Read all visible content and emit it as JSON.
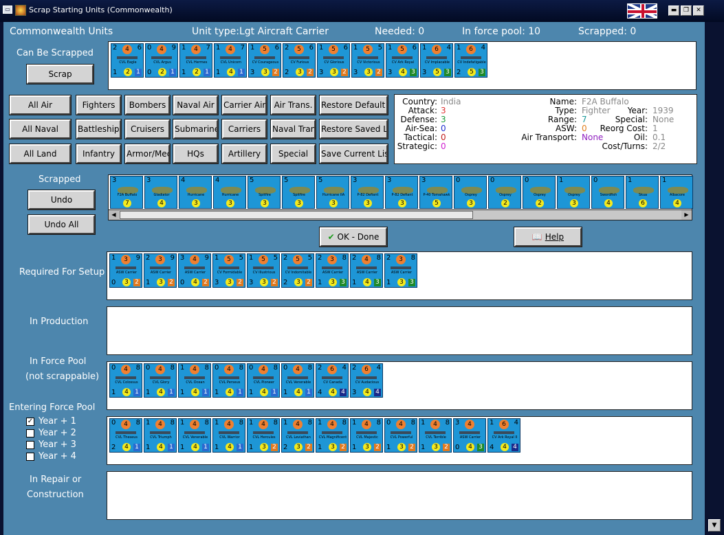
{
  "window": {
    "title": "Scrap Starting Units (Commonwealth)"
  },
  "header": {
    "units_title": "Commonwealth Units",
    "unit_type": "Unit type:Lgt Aircraft Carrier",
    "needed": "Needed:  0",
    "in_force_pool": "In force pool: 10",
    "scrapped": "Scrapped:  0"
  },
  "labels": {
    "can_be_scrapped": "Can Be Scrapped",
    "scrapped": "Scrapped",
    "required_for_setup": "Required For Setup",
    "in_production": "In Production",
    "in_force_pool": "In Force Pool",
    "not_scrappable": "(not scrappable)",
    "entering_force_pool": "Entering Force Pool",
    "in_repair": "In Repair or",
    "construction": "Construction"
  },
  "buttons": {
    "scrap": "Scrap",
    "undo": "Undo",
    "undo_all": "Undo All",
    "ok_done": "OK - Done",
    "help": "Help",
    "all_air": "All Air",
    "fighters": "Fighters",
    "bombers": "Bombers",
    "naval_air": "Naval Air",
    "carrier_air": "Carrier Air",
    "air_trans": "Air Trans.",
    "restore_default": "Restore Default List",
    "all_naval": "All Naval",
    "battleships": "Battleships",
    "cruisers": "Cruisers",
    "submarines": "Submarines",
    "carriers": "Carriers",
    "naval_trans": "Naval Trans.",
    "restore_saved": "Restore Saved List",
    "all_land": "All Land",
    "infantry": "Infantry",
    "armor_mech": "Armor/Mech",
    "hqs": "HQs",
    "artillery": "Artillery",
    "special": "Special",
    "save_current": "Save Current List"
  },
  "info": {
    "country_label": "Country:",
    "country": "India",
    "attack_label": "Attack:",
    "attack": "3",
    "defense_label": "Defense:",
    "defense": "3",
    "air_sea_label": "Air-Sea:",
    "air_sea": "0",
    "tactical_label": "Tactical:",
    "tactical": "0",
    "strategic_label": "Strategic:",
    "strategic": "0",
    "name_label": "Name:",
    "name": "F2A Buffalo",
    "type_label": "Type:",
    "type": "Fighter",
    "range_label": "Range:",
    "range": "7",
    "asw_label": "ASW:",
    "asw": "0",
    "air_transport_label": "Air Transport:",
    "air_transport": "None",
    "year_label": "Year:",
    "year": "1939",
    "special_label": "Special:",
    "special": "None",
    "reorg_label": "Reorg Cost:",
    "reorg": "1",
    "oil_label": "Oil:",
    "oil": "0.1",
    "cost_label": "Cost/Turns:",
    "cost": "2/2"
  },
  "entering": [
    {
      "label": "Year + 1",
      "checked": "✓"
    },
    {
      "label": "Year + 2",
      "checked": ""
    },
    {
      "label": "Year + 3",
      "checked": ""
    },
    {
      "label": "Year + 4",
      "checked": ""
    }
  ],
  "can_be_scrapped_units": [
    {
      "tl": "2",
      "c1": "4",
      "tr": "6",
      "name": "CVL Eagle",
      "bl": "1",
      "bc": "2",
      "br": "1",
      "brc": "#2a6ad0"
    },
    {
      "tl": "0",
      "c1": "4",
      "tr": "9",
      "name": "CVL Argus",
      "bl": "0",
      "bc": "2",
      "br": "1",
      "brc": "#2a6ad0"
    },
    {
      "tl": "1",
      "c1": "4",
      "tr": "7",
      "name": "CVL Hermes",
      "bl": "1",
      "bc": "2",
      "br": "1",
      "brc": "#2a6ad0"
    },
    {
      "tl": "1",
      "c1": "4",
      "tr": "7",
      "name": "CVL Unicorn",
      "bl": "1",
      "bc": "4",
      "br": "1",
      "brc": "#2a6ad0"
    },
    {
      "tl": "1",
      "c1": "5",
      "tr": "6",
      "name": "CV Courageous",
      "bl": "3",
      "bc": "3",
      "br": "2",
      "brc": "#e07a20"
    },
    {
      "tl": "2",
      "c1": "5",
      "tr": "6",
      "name": "CV Furious",
      "bl": "2",
      "bc": "3",
      "br": "2",
      "brc": "#e07a20"
    },
    {
      "tl": "1",
      "c1": "5",
      "tr": "6",
      "name": "CV Glorious",
      "bl": "3",
      "bc": "3",
      "br": "2",
      "brc": "#e07a20"
    },
    {
      "tl": "1",
      "c1": "5",
      "tr": "5",
      "name": "CV Victorious",
      "bl": "3",
      "bc": "3",
      "br": "2",
      "brc": "#e07a20"
    },
    {
      "tl": "1",
      "c1": "5",
      "tr": "6",
      "name": "CV Ark Royal",
      "bl": "3",
      "bc": "4",
      "br": "3",
      "brc": "#1f8a2a"
    },
    {
      "tl": "1",
      "c1": "6",
      "tr": "4",
      "name": "CV Implacable",
      "bl": "3",
      "bc": "5",
      "br": "3",
      "brc": "#1f8a2a"
    },
    {
      "tl": "1",
      "c1": "6",
      "tr": "4",
      "name": "CV Indefatigable",
      "bl": "2",
      "bc": "5",
      "br": "3",
      "brc": "#1f8a2a"
    }
  ],
  "scrapped_units": [
    {
      "tl": "3",
      "name": "F2A Buffalo",
      "bc": "7"
    },
    {
      "tl": "3",
      "name": "Gladiator",
      "bc": "4"
    },
    {
      "tl": "4",
      "name": "Hurricane",
      "bc": "3"
    },
    {
      "tl": "4",
      "name": "Hurricane",
      "bc": "3"
    },
    {
      "tl": "5",
      "name": "Spitfire",
      "bc": "3"
    },
    {
      "tl": "5",
      "name": "Spitfire",
      "bc": "3"
    },
    {
      "tl": "5",
      "name": "Hurricane IIA",
      "bc": "3"
    },
    {
      "tl": "3",
      "name": "P-82 Defiant",
      "bc": "3"
    },
    {
      "tl": "3",
      "name": "P-82 Defiant",
      "bc": "3"
    },
    {
      "tl": "3",
      "name": "P-40 Tomahawk",
      "bc": "5"
    },
    {
      "tl": "0",
      "name": "Osprey",
      "bc": "3"
    },
    {
      "tl": "0",
      "name": "Osprey",
      "bc": "2"
    },
    {
      "tl": "0",
      "name": "Osprey",
      "bc": "2"
    },
    {
      "tl": "1",
      "name": "Osprey",
      "bc": "3"
    },
    {
      "tl": "0",
      "name": "Swordfish",
      "bc": "4"
    },
    {
      "tl": "1",
      "name": "Skua",
      "bc": "6"
    },
    {
      "tl": "1",
      "name": "Albacore",
      "bc": "4"
    }
  ],
  "required_units": [
    {
      "tl": "1",
      "c1": "3",
      "tr": "9",
      "name": "ASW Carrier",
      "bl": "0",
      "bc": "3",
      "br": "2",
      "brc": "#e07a20"
    },
    {
      "tl": "2",
      "c1": "3",
      "tr": "9",
      "name": "ASW Carrier",
      "bl": "1",
      "bc": "3",
      "br": "2",
      "brc": "#e07a20"
    },
    {
      "tl": "3",
      "c1": "4",
      "tr": "9",
      "name": "ASW Carrier",
      "bl": "0",
      "bc": "4",
      "br": "2",
      "brc": "#e07a20"
    },
    {
      "tl": "1",
      "c1": "5",
      "tr": "5",
      "name": "CV Formidable",
      "bl": "3",
      "bc": "3",
      "br": "2",
      "brc": "#e07a20"
    },
    {
      "tl": "1",
      "c1": "5",
      "tr": "5",
      "name": "CV Illustrious",
      "bl": "3",
      "bc": "3",
      "br": "2",
      "brc": "#e07a20"
    },
    {
      "tl": "2",
      "c1": "5",
      "tr": "5",
      "name": "CV Indomitable",
      "bl": "2",
      "bc": "3",
      "br": "2",
      "brc": "#e07a20"
    },
    {
      "tl": "2",
      "c1": "3",
      "tr": "8",
      "name": "ASW Carrier",
      "bl": "1",
      "bc": "3",
      "br": "3",
      "brc": "#1f8a2a"
    },
    {
      "tl": "2",
      "c1": "4",
      "tr": "8",
      "name": "ASW Carrier",
      "bl": "1",
      "bc": "4",
      "br": "3",
      "brc": "#1f8a2a"
    },
    {
      "tl": "2",
      "c1": "3",
      "tr": "8",
      "name": "ASW Carrier",
      "bl": "1",
      "bc": "3",
      "br": "3",
      "brc": "#1f8a2a"
    }
  ],
  "force_pool_units": [
    {
      "tl": "0",
      "c1": "4",
      "tr": "8",
      "name": "CVL Colossus",
      "bl": "1",
      "bc": "4",
      "br": "1",
      "brc": "#2a6ad0"
    },
    {
      "tl": "0",
      "c1": "4",
      "tr": "8",
      "name": "CVL Glory",
      "bl": "1",
      "bc": "4",
      "br": "1",
      "brc": "#2a6ad0"
    },
    {
      "tl": "1",
      "c1": "4",
      "tr": "8",
      "name": "CVL Ocean",
      "bl": "1",
      "bc": "4",
      "br": "1",
      "brc": "#2a6ad0"
    },
    {
      "tl": "0",
      "c1": "4",
      "tr": "8",
      "name": "CVL Perseus",
      "bl": "1",
      "bc": "4",
      "br": "1",
      "brc": "#2a6ad0"
    },
    {
      "tl": "0",
      "c1": "4",
      "tr": "8",
      "name": "CVL Pioneer",
      "bl": "1",
      "bc": "4",
      "br": "1",
      "brc": "#2a6ad0"
    },
    {
      "tl": "0",
      "c1": "4",
      "tr": "8",
      "name": "CVL Venerable",
      "bl": "1",
      "bc": "4",
      "br": "1",
      "brc": "#2a6ad0"
    },
    {
      "tl": "2",
      "c1": "6",
      "tr": "4",
      "name": "CV Canada",
      "bl": "4",
      "bc": "4",
      "br": "4",
      "brc": "#1a2a8a"
    },
    {
      "tl": "2",
      "c1": "6",
      "tr": "4",
      "name": "CV Audacious",
      "bl": "3",
      "bc": "4",
      "br": "4",
      "brc": "#1a2a8a"
    }
  ],
  "entering_units": [
    {
      "tl": "0",
      "c1": "4",
      "tr": "8",
      "name": "CVL Theseus",
      "bl": "2",
      "bc": "4",
      "br": "1",
      "brc": "#2a6ad0"
    },
    {
      "tl": "1",
      "c1": "4",
      "tr": "8",
      "name": "CVL Triumph",
      "bl": "1",
      "bc": "4",
      "br": "1",
      "brc": "#2a6ad0"
    },
    {
      "tl": "1",
      "c1": "4",
      "tr": "8",
      "name": "CVL Venerable",
      "bl": "1",
      "bc": "4",
      "br": "1",
      "brc": "#2a6ad0"
    },
    {
      "tl": "1",
      "c1": "4",
      "tr": "8",
      "name": "CVL Warrior",
      "bl": "1",
      "bc": "4",
      "br": "1",
      "brc": "#2a6ad0"
    },
    {
      "tl": "1",
      "c1": "4",
      "tr": "8",
      "name": "CVL Hercules",
      "bl": "1",
      "bc": "3",
      "br": "2",
      "brc": "#e07a20"
    },
    {
      "tl": "1",
      "c1": "4",
      "tr": "8",
      "name": "CVL Leviathan",
      "bl": "2",
      "bc": "3",
      "br": "2",
      "brc": "#e07a20"
    },
    {
      "tl": "1",
      "c1": "4",
      "tr": "8",
      "name": "CVL Magnificent",
      "bl": "1",
      "bc": "3",
      "br": "2",
      "brc": "#e07a20"
    },
    {
      "tl": "1",
      "c1": "4",
      "tr": "8",
      "name": "CVL Majestic",
      "bl": "1",
      "bc": "3",
      "br": "2",
      "brc": "#e07a20"
    },
    {
      "tl": "0",
      "c1": "4",
      "tr": "8",
      "name": "CVL Powerful",
      "bl": "1",
      "bc": "3",
      "br": "2",
      "brc": "#e07a20"
    },
    {
      "tl": "1",
      "c1": "4",
      "tr": "8",
      "name": "CVL Terrible",
      "bl": "1",
      "bc": "3",
      "br": "2",
      "brc": "#e07a20"
    },
    {
      "tl": "3",
      "c1": "4",
      "tr": "",
      "name": "ASW Carrier",
      "bl": "0",
      "bc": "4",
      "br": "3",
      "brc": "#1f8a2a"
    },
    {
      "tl": "1",
      "c1": "6",
      "tr": "4",
      "name": "CV Ark Royal II",
      "bl": "4",
      "bc": "4",
      "br": "4",
      "brc": "#1a2a8a"
    }
  ]
}
